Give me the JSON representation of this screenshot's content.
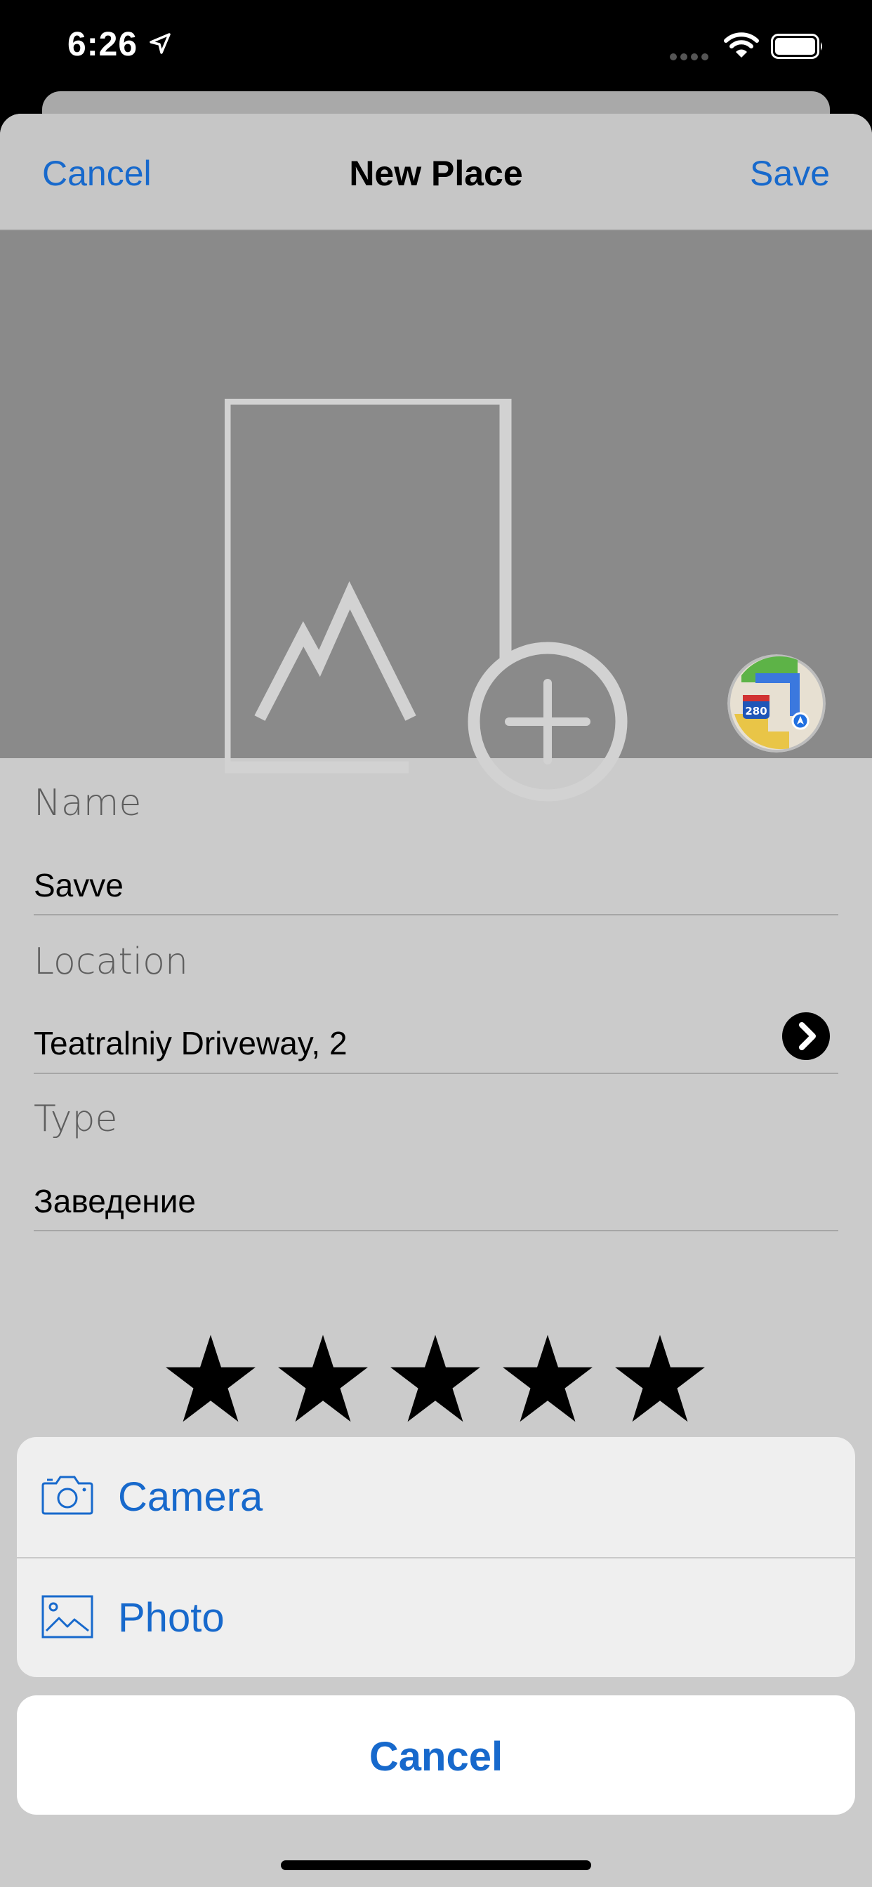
{
  "status_bar": {
    "time": "6:26",
    "icons": [
      "location-arrow-icon",
      "signal-dots-icon",
      "wifi-icon",
      "battery-icon"
    ]
  },
  "navbar": {
    "cancel_label": "Cancel",
    "title": "New Place",
    "save_label": "Save"
  },
  "image_section": {
    "placeholder_icon": "add-image-icon",
    "maps_icon": "maps-app-icon",
    "maps_badge_text": "280"
  },
  "form": {
    "name": {
      "label": "Name",
      "value": "Savve"
    },
    "location": {
      "label": "Location",
      "value": "Teatralniy Driveway, 2",
      "icon": "chevron-right-circle-icon"
    },
    "type": {
      "label": "Type",
      "value": "Заведение"
    }
  },
  "rating": {
    "value": 5,
    "max": 5
  },
  "action_sheet": {
    "items": [
      {
        "label": "Camera",
        "icon": "camera-icon"
      },
      {
        "label": "Photo",
        "icon": "photo-icon"
      }
    ],
    "cancel_label": "Cancel"
  },
  "colors": {
    "accent": "#1769cc",
    "sheet_background": "#cbcbcb",
    "image_background": "#8a8a8a"
  }
}
